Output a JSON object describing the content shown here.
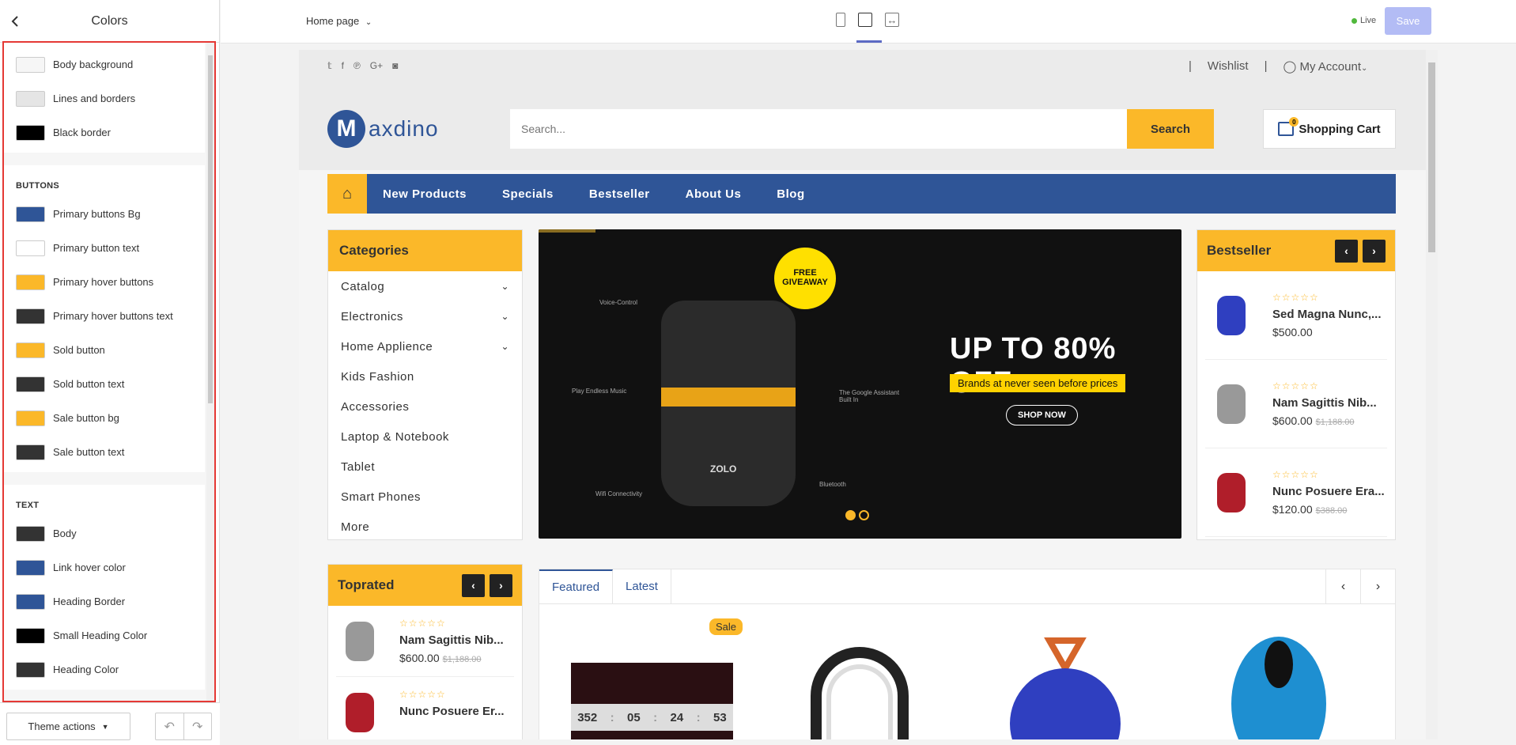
{
  "sidebar": {
    "title": "Colors",
    "general": [
      {
        "label": "Body background",
        "color": "#f6f6f6"
      },
      {
        "label": "Lines and borders",
        "color": "#e5e5e5"
      },
      {
        "label": "Black border",
        "color": "#000000"
      }
    ],
    "buttons_title": "BUTTONS",
    "buttons": [
      {
        "label": "Primary buttons Bg",
        "color": "#2f5597"
      },
      {
        "label": "Primary button text",
        "color": "#ffffff"
      },
      {
        "label": "Primary hover buttons",
        "color": "#fbb829"
      },
      {
        "label": "Primary hover buttons text",
        "color": "#333333"
      },
      {
        "label": "Sold button",
        "color": "#fbb829"
      },
      {
        "label": "Sold button text",
        "color": "#333333"
      },
      {
        "label": "Sale button bg",
        "color": "#fbb829"
      },
      {
        "label": "Sale button text",
        "color": "#333333"
      }
    ],
    "text_title": "TEXT",
    "text": [
      {
        "label": "Body",
        "color": "#333333"
      },
      {
        "label": "Link hover color",
        "color": "#2f5597"
      },
      {
        "label": "Heading Border",
        "color": "#2f5597"
      },
      {
        "label": "Small Heading Color",
        "color": "#000000"
      },
      {
        "label": "Heading Color",
        "color": "#333333"
      }
    ],
    "theme_actions": "Theme actions"
  },
  "topbar": {
    "page": "Home page",
    "live": "Live",
    "save": "Save"
  },
  "store": {
    "top_links": [
      "|",
      "Wishlist",
      "|",
      "My Account"
    ],
    "logo_m": "M",
    "logo_text": "axdino",
    "search_placeholder": "Search...",
    "search_button": "Search",
    "cart_count": "0",
    "cart_label": "Shopping Cart",
    "nav": [
      "New Products",
      "Specials",
      "Bestseller",
      "About Us",
      "Blog"
    ],
    "categories_title": "Categories",
    "categories": [
      {
        "label": "Catalog",
        "arrow": true
      },
      {
        "label": "Electronics",
        "arrow": true
      },
      {
        "label": "Home Applience",
        "arrow": true
      },
      {
        "label": "Kids Fashion",
        "arrow": false
      },
      {
        "label": "Accessories",
        "arrow": false
      },
      {
        "label": "Laptop & Notebook",
        "arrow": false
      },
      {
        "label": "Tablet",
        "arrow": false
      },
      {
        "label": "Smart Phones",
        "arrow": false
      },
      {
        "label": "More",
        "arrow": false
      }
    ],
    "banner": {
      "giveaway": "FREE GIVEAWAY",
      "headline": "UP TO 80% OFF",
      "subline": "Brands at never seen before prices",
      "cta": "SHOP NOW",
      "features": [
        "Voice-Control",
        "Play Endless Music",
        "The Google Assistant Built In",
        "Bluetooth",
        "Wifi Connectivity"
      ],
      "brand": "ZOLO"
    },
    "bestseller_title": "Bestseller",
    "bestseller": [
      {
        "name": "Sed Magna Nunc,...",
        "price": "$500.00",
        "old": ""
      },
      {
        "name": "Nam Sagittis Nib...",
        "price": "$600.00",
        "old": "$1,188.00"
      },
      {
        "name": "Nunc Posuere Era...",
        "price": "$120.00",
        "old": "$388.00"
      }
    ],
    "toprated_title": "Toprated",
    "toprated": [
      {
        "name": "Nam Sagittis Nib...",
        "price": "$600.00",
        "old": "$1,188.00"
      },
      {
        "name": "Nunc Posuere Er...",
        "price": "",
        "old": ""
      }
    ],
    "tabs": [
      "Featured",
      "Latest"
    ],
    "sale_badge": "Sale",
    "countdown": [
      "352",
      "05",
      "24",
      "53"
    ]
  }
}
